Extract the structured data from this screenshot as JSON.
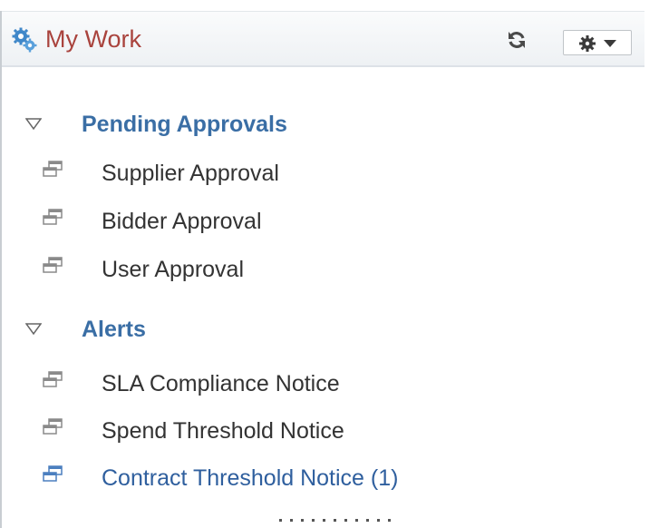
{
  "pagelet": {
    "title": "My Work",
    "title_icon": "gears-icon",
    "refresh_icon": "refresh-icon",
    "actions_icon": "gear-dropdown-icon"
  },
  "sections": [
    {
      "label": "Pending Approvals",
      "expanded": true,
      "items": [
        {
          "label": "Supplier Approval",
          "icon": "worklist-icon"
        },
        {
          "label": "Bidder Approval",
          "icon": "worklist-icon"
        },
        {
          "label": "User Approval",
          "icon": "worklist-icon"
        }
      ]
    },
    {
      "label": "Alerts",
      "expanded": true,
      "items": [
        {
          "label": "SLA Compliance Notice",
          "icon": "worklist-icon"
        },
        {
          "label": "Spend Threshold Notice",
          "icon": "worklist-icon"
        },
        {
          "label": "Contract Threshold Notice (1)",
          "icon": "worklist-icon",
          "active": true
        }
      ]
    }
  ],
  "more_indicator": "more-dots",
  "colors": {
    "title": "#a9433d",
    "section_label": "#3a6ea5",
    "item_text": "#333333",
    "active_item": "#2f5f9e",
    "header_border": "#dde2e7"
  }
}
